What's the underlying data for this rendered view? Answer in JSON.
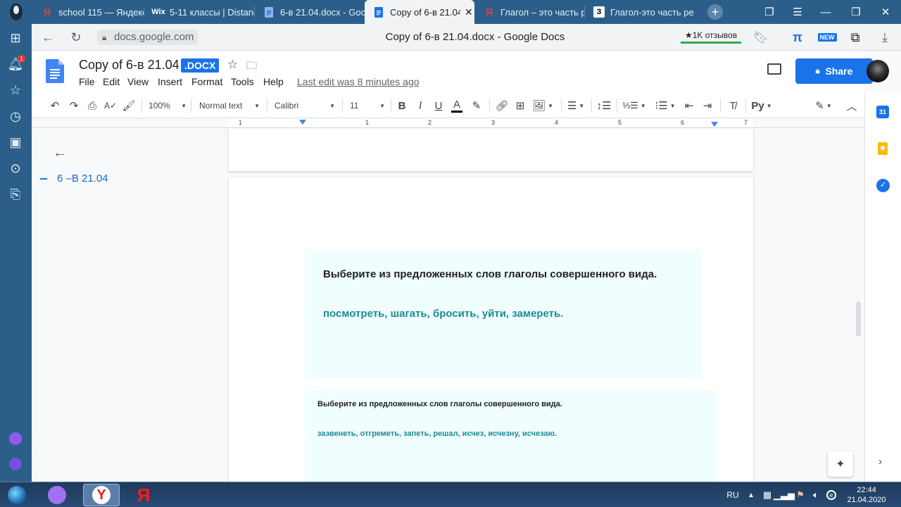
{
  "browser": {
    "tabs": [
      {
        "title": "school 115 — Яндекс",
        "favicon": "Я",
        "favcolor": "#ff3333"
      },
      {
        "title": "5-11 классы | Distanc",
        "favicon": "W",
        "favcolor": "#ffffff"
      },
      {
        "title": "6-в 21.04.docx - Goo",
        "favicon": "≡",
        "favcolor": "#8ab4f8"
      },
      {
        "title": "Copy of 6-в 21.04",
        "favicon": "≡",
        "favcolor": "#1a73e8",
        "active": true
      },
      {
        "title": "Глагол – это часть ре",
        "favicon": "Я",
        "favcolor": "#ff3333"
      },
      {
        "title": "Глагол-это часть ре",
        "favicon": "З",
        "favcolor": "#ffffff"
      }
    ],
    "url": "docs.google.com",
    "page_title": "Copy of 6-в 21.04.docx - Google Docs",
    "reviews": "★1K отзывов",
    "new_badge": "NEW",
    "sidebar_badge": "1"
  },
  "doc": {
    "title": "Copy of 6-в 21.04",
    "badge": ".DOCX",
    "menus": [
      "File",
      "Edit",
      "View",
      "Insert",
      "Format",
      "Tools",
      "Help"
    ],
    "last_edit": "Last edit was 8 minutes ago",
    "share": "Share"
  },
  "toolbar": {
    "zoom": "100%",
    "style": "Normal text",
    "font": "Calibri",
    "size": "11"
  },
  "ruler": [
    "1",
    "1",
    "2",
    "3",
    "4",
    "5",
    "6",
    "7"
  ],
  "outline": {
    "heading": "6 –В 21.04"
  },
  "content": {
    "box1": {
      "instruction": "Выберите из предложенных слов глаголы совершенного вида.",
      "words": "посмотреть, шагать, бросить, уйти, замереть."
    },
    "box2": {
      "instruction": "Выберите из предложенных слов глаголы совершенного вида.",
      "words": "зазвенеть, отгреметь, запеть, решал, исчез, исчезну, исчезаю."
    }
  },
  "taskbar": {
    "lang": "RU",
    "time": "22:44",
    "date": "21.04.2020"
  },
  "colors": {
    "tabstrip": "#2b5f8a",
    "accent": "#1a73e8",
    "instruction": "#202124",
    "words": "#1a8c94",
    "box": "#f0feff"
  }
}
